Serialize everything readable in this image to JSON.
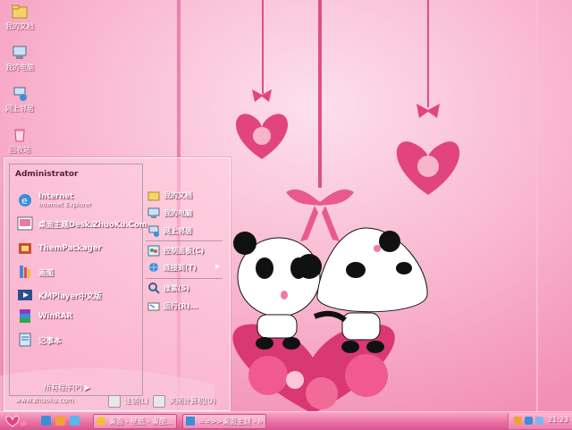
{
  "desktop_icons": [
    {
      "label": "我的文档",
      "icon": "folder-icon"
    },
    {
      "label": "我的电脑",
      "icon": "computer-icon"
    },
    {
      "label": "网上邻居",
      "icon": "network-icon"
    },
    {
      "label": "回收站",
      "icon": "recycle-bin-icon"
    }
  ],
  "start_menu": {
    "user_name": "Administrator",
    "pinned": [
      {
        "title": "Internet",
        "subtitle": "Internet Explorer",
        "icon": "internet-explorer-icon"
      },
      {
        "title": "桌面主题Desk.ZhuoKu.Com",
        "subtitle": "",
        "icon": "theme-icon"
      }
    ],
    "recent": [
      {
        "title": "ThemPackager",
        "icon": "packager-icon"
      },
      {
        "title": "画图",
        "icon": "paint-icon"
      },
      {
        "title": "KMPlayer中文版",
        "icon": "media-player-icon"
      },
      {
        "title": "WinRAR",
        "icon": "winrar-icon"
      },
      {
        "title": "记事本",
        "icon": "notepad-icon"
      }
    ],
    "all_programs": "所有程序(P)",
    "site_url": "www.zhuoku.com",
    "right_items": [
      {
        "label": "我的文档",
        "icon": "folder-icon"
      },
      {
        "label": "我的电脑",
        "icon": "computer-icon"
      },
      {
        "label": "网上邻居",
        "icon": "network-icon"
      },
      {
        "label": "控制面板(C)",
        "icon": "control-panel-icon"
      },
      {
        "label": "连接到(T)",
        "icon": "connect-icon",
        "arrow": "▶"
      },
      {
        "label": "搜索(S)",
        "icon": "search-icon"
      },
      {
        "label": "运行(R)...",
        "icon": "run-icon"
      }
    ],
    "logoff_label": "注销(L)",
    "shutdown_label": "关闭计算机(U)"
  },
  "taskbar": {
    "tasks": [
      {
        "label": "桌面 - 壁纸 - 桌酷...",
        "icon": "browser-icon"
      },
      {
        "label": "==>>桌面主题 - M...",
        "icon": "window-icon"
      }
    ],
    "clock": "21:23"
  },
  "colors": {
    "wallpaper_bg": "#f7a9c4",
    "heart": "#e2457e",
    "taskbar": "#e86ea2"
  }
}
